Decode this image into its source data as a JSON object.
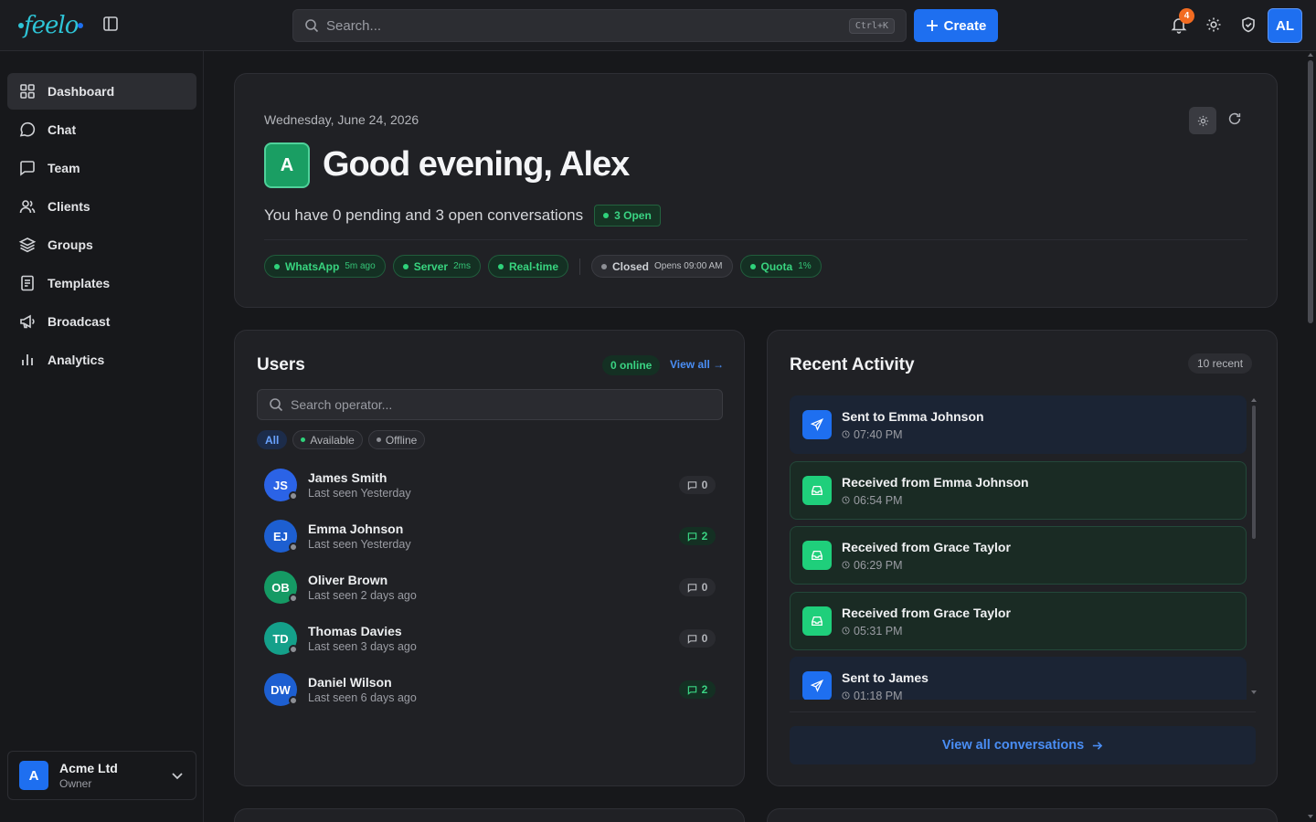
{
  "app": {
    "logo_text": "feelo",
    "search_placeholder": "Search...",
    "search_shortcut": "Ctrl+K",
    "create_label": "Create",
    "notification_count": "4",
    "user_initials": "AL",
    "accent_color": "#1e6ff0"
  },
  "sidebar": {
    "items": [
      {
        "label": "Dashboard",
        "icon": "dashboard-icon",
        "active": true
      },
      {
        "label": "Chat",
        "icon": "chat-icon"
      },
      {
        "label": "Team",
        "icon": "team-icon"
      },
      {
        "label": "Clients",
        "icon": "clients-icon"
      },
      {
        "label": "Groups",
        "icon": "groups-icon"
      },
      {
        "label": "Templates",
        "icon": "templates-icon"
      },
      {
        "label": "Broadcast",
        "icon": "broadcast-icon"
      },
      {
        "label": "Analytics",
        "icon": "analytics-icon"
      }
    ],
    "org": {
      "initial": "A",
      "name": "Acme Ltd",
      "role": "Owner"
    }
  },
  "hero": {
    "date": "Wednesday, June 24, 2026",
    "avatar_initial": "A",
    "greeting": "Good evening, Alex",
    "summary": "You have 0 pending and 3 open conversations",
    "open_badge": "3 Open",
    "chips": [
      {
        "label": "WhatsApp",
        "meta": "5m ago",
        "status": "green"
      },
      {
        "label": "Server",
        "meta": "2ms",
        "status": "green"
      },
      {
        "label": "Real-time",
        "meta": "",
        "status": "green"
      },
      {
        "label": "Closed",
        "meta": "Opens 09:00 AM",
        "status": "gray"
      },
      {
        "label": "Quota",
        "meta": "1%",
        "status": "green"
      }
    ]
  },
  "users": {
    "title": "Users",
    "online_badge": "0 online",
    "view_all": "View all →",
    "search_placeholder": "Search operator...",
    "filters": [
      "All",
      "Available",
      "Offline"
    ],
    "list": [
      {
        "initials": "JS",
        "name": "James Smith",
        "seen": "Last seen Yesterday",
        "count": "0",
        "color": "#2b63e6"
      },
      {
        "initials": "EJ",
        "name": "Emma Johnson",
        "seen": "Last seen Yesterday",
        "count": "2",
        "color": "#1d5fd1"
      },
      {
        "initials": "OB",
        "name": "Oliver Brown",
        "seen": "Last seen 2 days ago",
        "count": "0",
        "color": "#159a64"
      },
      {
        "initials": "TD",
        "name": "Thomas Davies",
        "seen": "Last seen 3 days ago",
        "count": "0",
        "color": "#14a08a"
      },
      {
        "initials": "DW",
        "name": "Daniel Wilson",
        "seen": "Last seen 6 days ago",
        "count": "2",
        "color": "#1d5fd1"
      }
    ]
  },
  "activity": {
    "title": "Recent Activity",
    "recent_badge": "10 recent",
    "items": [
      {
        "type": "sent",
        "title": "Sent to Emma Johnson",
        "time": "07:40 PM"
      },
      {
        "type": "received",
        "title": "Received from Emma Johnson",
        "time": "06:54 PM"
      },
      {
        "type": "received",
        "title": "Received from Grace Taylor",
        "time": "06:29 PM"
      },
      {
        "type": "received",
        "title": "Received from Grace Taylor",
        "time": "05:31 PM"
      },
      {
        "type": "sent",
        "title": "Sent to James",
        "time": "01:18 PM"
      }
    ],
    "view_all": "View all conversations"
  }
}
